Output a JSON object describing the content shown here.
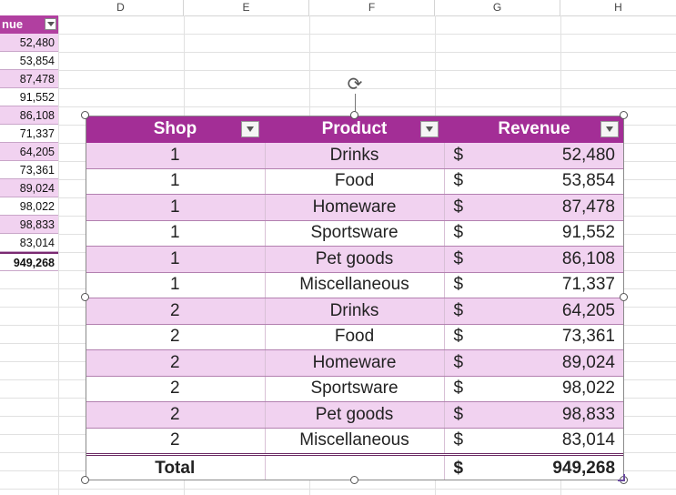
{
  "sheet": {
    "columns": [
      "D",
      "E",
      "F",
      "G",
      "H"
    ],
    "left_column": {
      "header": "nue",
      "values": [
        "52,480",
        "53,854",
        "87,478",
        "91,552",
        "86,108",
        "71,337",
        "64,205",
        "73,361",
        "89,024",
        "98,022",
        "98,833",
        "83,014"
      ],
      "total": "949,268"
    }
  },
  "picture_table": {
    "headers": [
      "Shop",
      "Product",
      "Revenue"
    ],
    "currency": "$",
    "rows": [
      {
        "shop": "1",
        "product": "Drinks",
        "revenue": "52,480"
      },
      {
        "shop": "1",
        "product": "Food",
        "revenue": "53,854"
      },
      {
        "shop": "1",
        "product": "Homeware",
        "revenue": "87,478"
      },
      {
        "shop": "1",
        "product": "Sportsware",
        "revenue": "91,552"
      },
      {
        "shop": "1",
        "product": "Pet goods",
        "revenue": "86,108"
      },
      {
        "shop": "1",
        "product": "Miscellaneous",
        "revenue": "71,337"
      },
      {
        "shop": "2",
        "product": "Drinks",
        "revenue": "64,205"
      },
      {
        "shop": "2",
        "product": "Food",
        "revenue": "73,361"
      },
      {
        "shop": "2",
        "product": "Homeware",
        "revenue": "89,024"
      },
      {
        "shop": "2",
        "product": "Sportsware",
        "revenue": "98,022"
      },
      {
        "shop": "2",
        "product": "Pet goods",
        "revenue": "98,833"
      },
      {
        "shop": "2",
        "product": "Miscellaneous",
        "revenue": "83,014"
      }
    ],
    "total": {
      "label": "Total",
      "currency": "$",
      "revenue": "949,268"
    }
  },
  "colors": {
    "header": "#a32e96",
    "band": "#f1d2f0"
  },
  "icons": {
    "rotate": "rotate-handle-icon",
    "filter": "filter-dropdown-icon"
  }
}
